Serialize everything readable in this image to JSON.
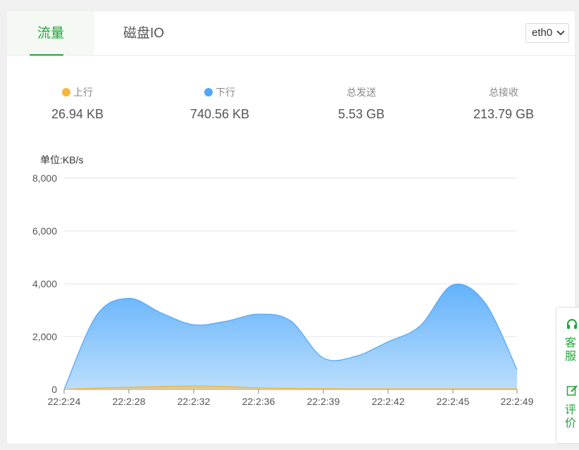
{
  "tabs": [
    {
      "label": "流量"
    },
    {
      "label": "磁盘IO"
    }
  ],
  "interface_select": {
    "value": "eth0"
  },
  "stats": [
    {
      "label": "上行",
      "value": "26.94 KB",
      "dot_color": "#f5b73b"
    },
    {
      "label": "下行",
      "value": "740.56 KB",
      "dot_color": "#52a6fb"
    },
    {
      "label": "总发送",
      "value": "5.53 GB"
    },
    {
      "label": "总接收",
      "value": "213.79 GB"
    }
  ],
  "chart_unit": "单位:KB/s",
  "chart_data": {
    "type": "area",
    "x": [
      "22:2:24",
      "22:2:26",
      "22:2:28",
      "22:2:30",
      "22:2:32",
      "22:2:34",
      "22:2:36",
      "22:2:37",
      "22:2:39",
      "22:2:40",
      "22:2:42",
      "22:2:43",
      "22:2:45",
      "22:2:47",
      "22:2:49"
    ],
    "x_ticks": [
      "22:2:24",
      "22:2:28",
      "22:2:32",
      "22:2:36",
      "22:2:39",
      "22:2:42",
      "22:2:45",
      "22:2:49"
    ],
    "ylim": [
      0,
      8000
    ],
    "y_ticks": [
      "8,000",
      "6,000",
      "4,000",
      "2,000",
      "0"
    ],
    "series": [
      {
        "name": "上行",
        "color": "#f5b73b",
        "values": [
          0,
          50,
          80,
          110,
          130,
          110,
          60,
          40,
          30,
          20,
          20,
          20,
          20,
          20,
          20
        ]
      },
      {
        "name": "下行",
        "color": "#52a6fb",
        "values": [
          0,
          2800,
          3450,
          2900,
          2450,
          2580,
          2850,
          2600,
          1200,
          1250,
          1800,
          2400,
          3950,
          3300,
          750
        ]
      }
    ],
    "grid": true
  },
  "side_widget": {
    "service_label": "客服",
    "review_label": "评价"
  }
}
